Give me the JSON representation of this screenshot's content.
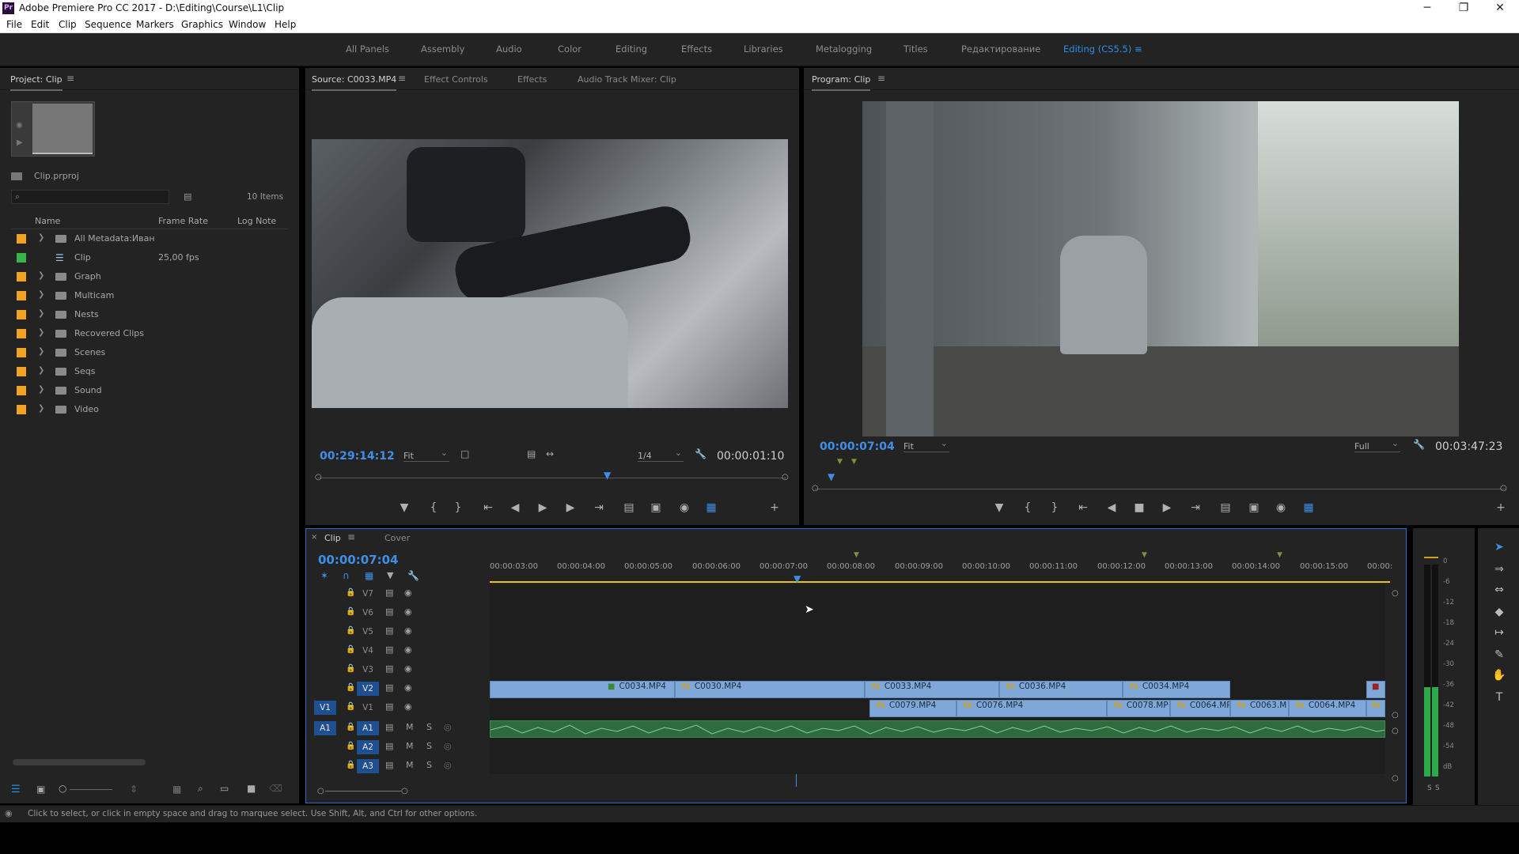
{
  "window": {
    "title": "Adobe Premiere Pro CC 2017 - D:\\Editing\\Course\\L1\\Clip",
    "app_icon": "Pr",
    "minimize": "─",
    "maximize": "❐",
    "close": "✕"
  },
  "menu": [
    "File",
    "Edit",
    "Clip",
    "Sequence",
    "Markers",
    "Graphics",
    "Window",
    "Help"
  ],
  "workspaces": {
    "items": [
      "All Panels",
      "Assembly",
      "Audio",
      "Color",
      "Editing",
      "Effects",
      "Libraries",
      "Metalogging",
      "Titles",
      "Редактирование",
      "Editing (CS5.5)"
    ],
    "active": "Editing (CS5.5)"
  },
  "project": {
    "tab": "Project: Clip",
    "file": "Clip.prproj",
    "items_count": "10 Items",
    "search_placeholder": "",
    "columns": [
      "Name",
      "Frame Rate",
      "Log Note"
    ],
    "rows": [
      {
        "name": "All Metadata:Иван",
        "rate": "",
        "color": "#f0a224",
        "kind": "folder"
      },
      {
        "name": "Clip",
        "rate": "25,00 fps",
        "color": "#3cb34a",
        "kind": "sequence"
      },
      {
        "name": "Graph",
        "rate": "",
        "color": "#f0a224",
        "kind": "folder"
      },
      {
        "name": "Multicam",
        "rate": "",
        "color": "#f0a224",
        "kind": "folder"
      },
      {
        "name": "Nests",
        "rate": "",
        "color": "#f0a224",
        "kind": "folder"
      },
      {
        "name": "Recovered Clips",
        "rate": "",
        "color": "#f0a224",
        "kind": "folder"
      },
      {
        "name": "Scenes",
        "rate": "",
        "color": "#f0a224",
        "kind": "folder"
      },
      {
        "name": "Seqs",
        "rate": "",
        "color": "#f0a224",
        "kind": "folder"
      },
      {
        "name": "Sound",
        "rate": "",
        "color": "#f0a224",
        "kind": "folder"
      },
      {
        "name": "Video",
        "rate": "",
        "color": "#f0a224",
        "kind": "folder"
      }
    ]
  },
  "source": {
    "tabs": [
      "Source: C0033.MP4",
      "Effect Controls",
      "Effects",
      "Audio Track Mixer: Clip"
    ],
    "timecode": "00:29:14:12",
    "zoom": "Fit",
    "resolution": "1/4",
    "duration": "00:00:01:10"
  },
  "program": {
    "tab": "Program: Clip",
    "timecode": "00:00:07:04",
    "zoom": "Fit",
    "resolution": "Full",
    "duration": "00:03:47:23"
  },
  "timeline": {
    "tabs": [
      "Clip",
      "Cover"
    ],
    "timecode": "00:00:07:04",
    "ruler": [
      "00:00:03:00",
      "00:00:04:00",
      "00:00:05:00",
      "00:00:06:00",
      "00:00:07:00",
      "00:00:08:00",
      "00:00:09:00",
      "00:00:10:00",
      "00:00:11:00",
      "00:00:12:00",
      "00:00:13:00",
      "00:00:14:00",
      "00:00:15:00",
      "00:00:"
    ],
    "video_tracks": [
      "V7",
      "V6",
      "V5",
      "V4",
      "V3",
      "V2",
      "V1"
    ],
    "audio_tracks": [
      "A1",
      "A2",
      "A3"
    ],
    "mute_label": "M",
    "solo_label": "S",
    "source_patch_v": "V1",
    "source_patch_a": "A1",
    "v2_clips": [
      "C0034.MP4",
      "C0030.MP4",
      "C0033.MP4",
      "C0036.MP4",
      "C0034.MP4"
    ],
    "v1_clips": [
      "C0079.MP4",
      "C0076.MP4",
      "C0078.MP",
      "C0064.MP",
      "C0063.M",
      "C0064.MP4"
    ]
  },
  "meters": {
    "db": [
      "0",
      "-6",
      "-12",
      "-18",
      "-24",
      "-30",
      "-36",
      "-42",
      "-48",
      "-54",
      "dB"
    ],
    "solo": [
      "S",
      "S"
    ],
    "level": 0.42
  },
  "status": "Click to select, or click in empty space and drag to marquee select. Use Shift, Alt, and Ctrl for other options."
}
